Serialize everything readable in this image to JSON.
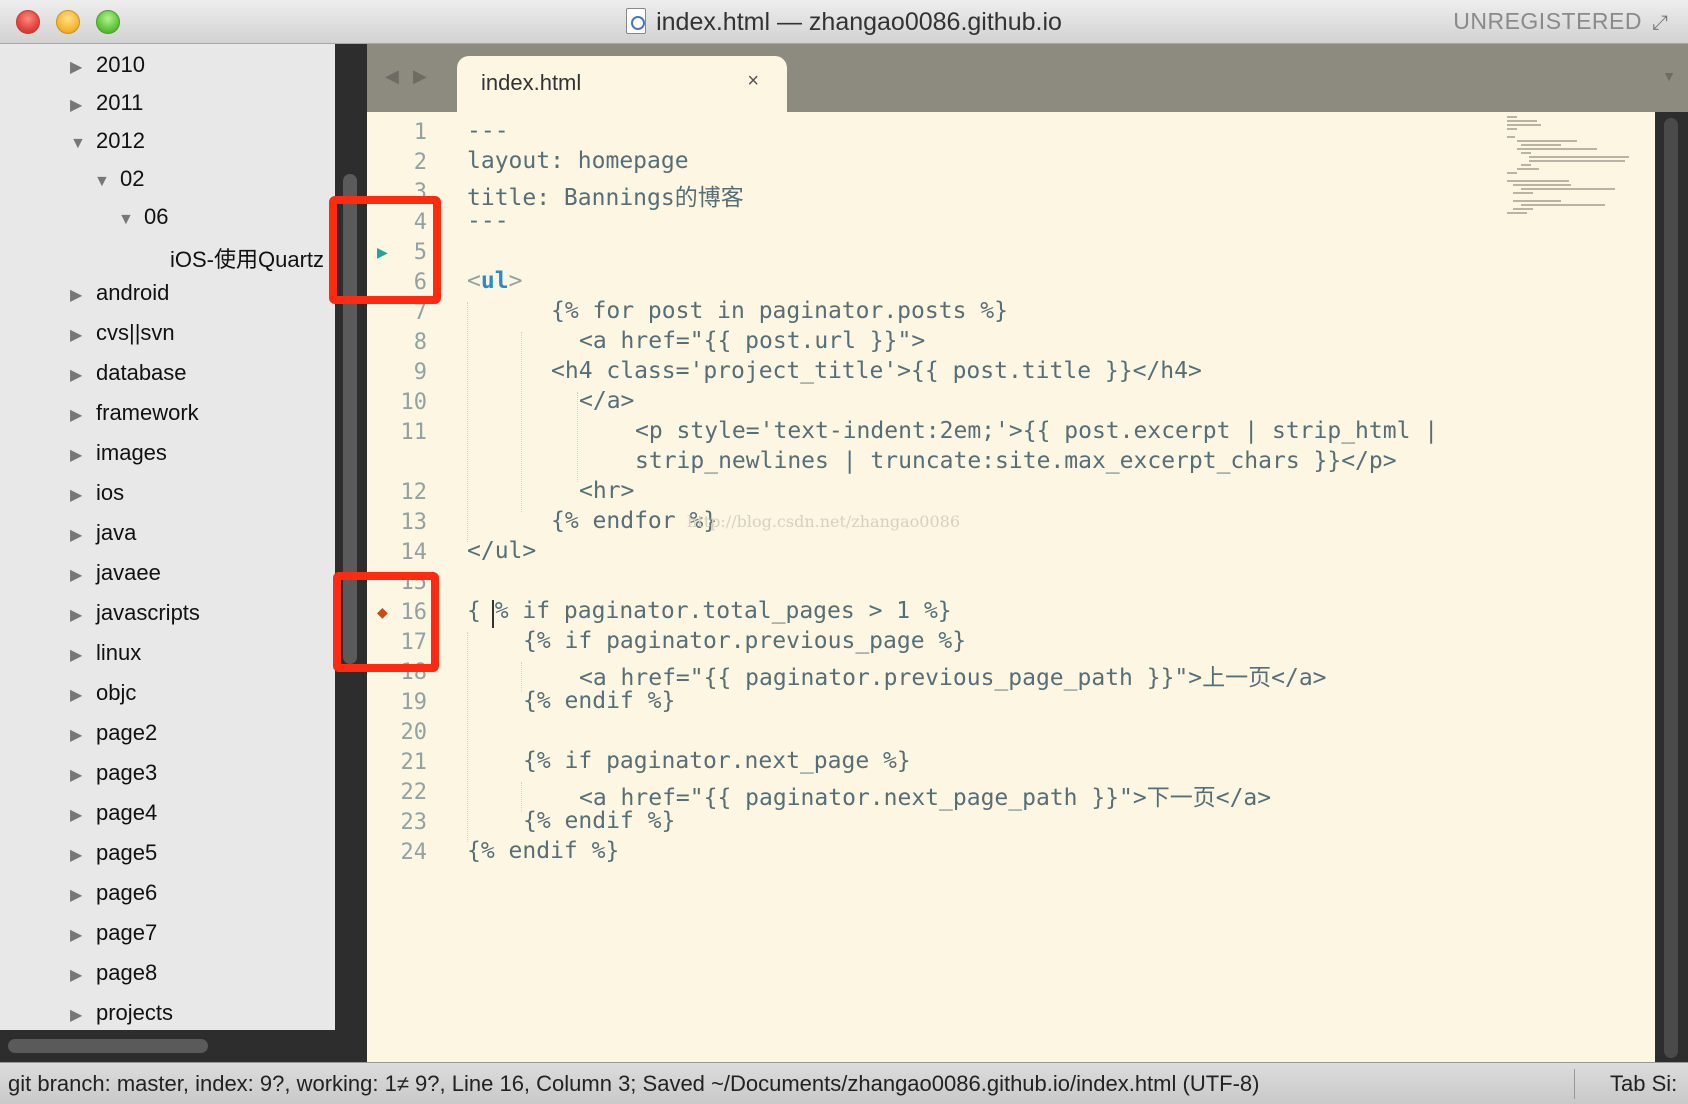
{
  "window": {
    "title": "index.html — zhangao0086.github.io",
    "registration": "UNREGISTERED"
  },
  "sidebar": {
    "items": [
      {
        "label": "2010",
        "expanded": false
      },
      {
        "label": "2011",
        "expanded": false
      },
      {
        "label": "2012",
        "expanded": true
      },
      {
        "label": "02",
        "expanded": true
      },
      {
        "label": "06",
        "expanded": true
      },
      {
        "label": "iOS-使用Quartz",
        "expanded": null
      },
      {
        "label": "android",
        "expanded": false
      },
      {
        "label": "cvs||svn",
        "expanded": false
      },
      {
        "label": "database",
        "expanded": false
      },
      {
        "label": "framework",
        "expanded": false
      },
      {
        "label": "images",
        "expanded": false
      },
      {
        "label": "ios",
        "expanded": false
      },
      {
        "label": "java",
        "expanded": false
      },
      {
        "label": "javaee",
        "expanded": false
      },
      {
        "label": "javascripts",
        "expanded": false
      },
      {
        "label": "linux",
        "expanded": false
      },
      {
        "label": "objc",
        "expanded": false
      },
      {
        "label": "page2",
        "expanded": false
      },
      {
        "label": "page3",
        "expanded": false
      },
      {
        "label": "page4",
        "expanded": false
      },
      {
        "label": "page5",
        "expanded": false
      },
      {
        "label": "page6",
        "expanded": false
      },
      {
        "label": "page7",
        "expanded": false
      },
      {
        "label": "page8",
        "expanded": false
      },
      {
        "label": "projects",
        "expanded": false
      }
    ]
  },
  "tabs": [
    {
      "label": "index.html",
      "close": "×"
    }
  ],
  "editor": {
    "line_numbers": [
      "1",
      "2",
      "3",
      "4",
      "5",
      "6",
      "7",
      "8",
      "9",
      "10",
      "11",
      "",
      "12",
      "13",
      "14",
      "15",
      "16",
      "17",
      "18",
      "19",
      "20",
      "21",
      "22",
      "23",
      "24"
    ],
    "watermark": "http://blog.csdn.net/zhangao0086",
    "lines": [
      "---",
      "layout: homepage",
      "title: Bannings的博客",
      "---",
      "",
      "<ul>",
      "{% for post in paginator.posts %}",
      "<a href=\"{{ post.url }}\">",
      "<h4 class='project_title'>{{ post.title }}</h4>",
      "</a>",
      "<p style='text-indent:2em;'>{{ post.excerpt | strip_html |",
      "strip_newlines | truncate:site.max_excerpt_chars }}</p>",
      "<hr>",
      "{% endfor %}",
      "</ul>",
      "",
      "{ % if paginator.total_pages > 1 %}",
      "{% if paginator.previous_page %}",
      "<a href=\"{{ paginator.previous_page_path }}\">上一页</a>",
      "{% endif %}",
      "",
      "{% if paginator.next_page %}",
      "<a href=\"{{ paginator.next_page_path }}\">下一页</a>",
      "{% endif %}",
      "{% endif %}"
    ]
  },
  "statusbar": {
    "text": "git branch: master, index: 9?, working: 1≠ 9?, Line 16, Column 3; Saved ~/Documents/zhangao0086.github.io/index.html (UTF-8)",
    "right": "Tab Si:"
  },
  "colors": {
    "highlight": "#ff2a10",
    "editor_bg": "#fdf6e3",
    "tag": "#268bd2",
    "string": "#2aa198"
  }
}
